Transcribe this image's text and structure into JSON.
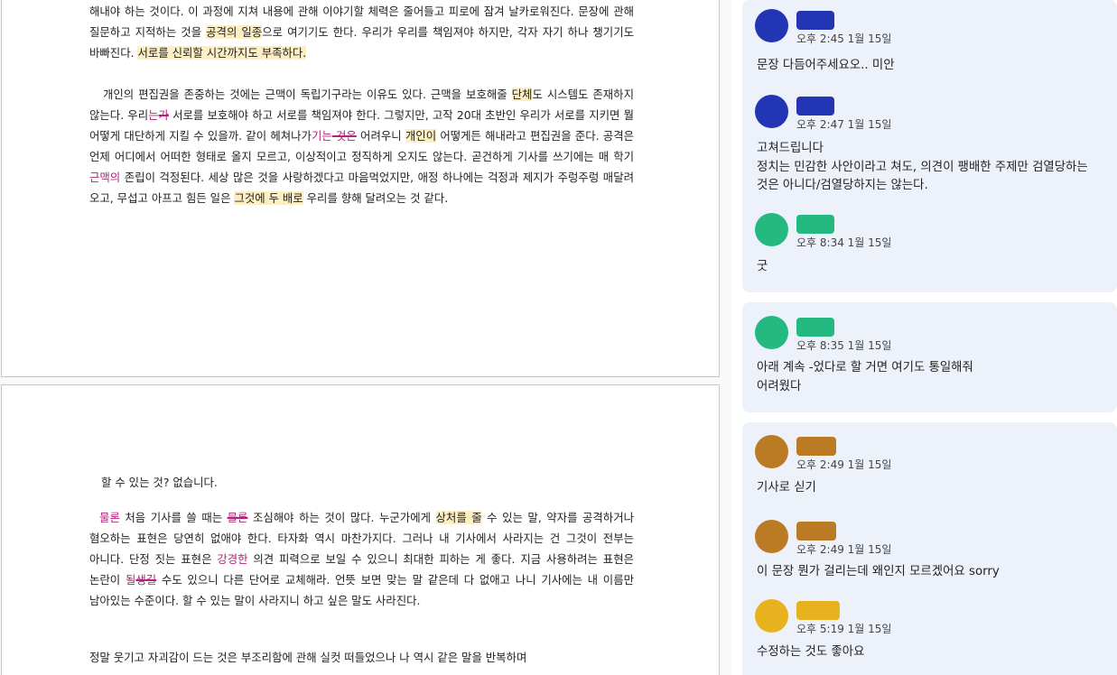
{
  "colors": {
    "highlight": "#fdefc3",
    "suggestion": "#b0247a",
    "thread_bg": "#edf2fa",
    "avatar_blue": "#2236b5",
    "avatar_green": "#25b982",
    "avatar_brown": "#bb7a24",
    "avatar_yellow": "#e8b21f"
  },
  "page1": {
    "para1": [
      {
        "t": "해내야 하는 것이다. 이 과정에 지쳐 내용에 관해 이야기할 체력은 줄어들고 피로에 잠겨 날카로워진다. 문장에 관해 질문하고 지적하는 것을 ",
        "s": ""
      },
      {
        "t": "공격의 일종",
        "s": "hl"
      },
      {
        "t": "으로 여기기도 한다. 우리가 우리를 책임져야 하지만, 각자 자기 하나 챙기기도 바빠진다. ",
        "s": ""
      },
      {
        "t": "서로를 신뢰할 시간까지도 부족하다.",
        "s": "hl"
      }
    ],
    "para2": [
      {
        "t": "   개인의 편집권을 존중하는 것에는 근맥이 독립기구라는 이유도 있다. 근맥을 보호해줄 ",
        "s": ""
      },
      {
        "t": "단체",
        "s": "hl"
      },
      {
        "t": "도 시스템도 존재하지 않는다. 우리",
        "s": ""
      },
      {
        "t": "는",
        "s": "ins"
      },
      {
        "t": "가",
        "s": "del"
      },
      {
        "t": " 서로를 보호해야 하고 서로를 책임져야 한다. 그렇지만, 고작 20대 초반인 우리가 서로를 지키면 뭘 어떻게 대단하게 지킬 수 있을까. 같이 헤쳐나가",
        "s": ""
      },
      {
        "t": "기는",
        "s": "ins"
      },
      {
        "t": " 것은",
        "s": "del"
      },
      {
        "t": " 어려우니 ",
        "s": ""
      },
      {
        "t": "개인이",
        "s": "hl"
      },
      {
        "t": " 어떻게든 해내라고 편집권을 준다. 공격은 언제 어디에서 어떠한 형태로 올지 모르고, 이상적이고 정직하게 오지도 않는다. 곧건하게 기사를 쓰기에는 매 학기 ",
        "s": ""
      },
      {
        "t": "근맥의",
        "s": "ins"
      },
      {
        "t": " 존립이 걱정된다. 세상 많은 것을 사랑하겠다고 마음먹었지만, 애정 하나에는 걱정과 제지가 주렁주렁 매달려 오고, 무섭고 아프고 힘든 일은 ",
        "s": ""
      },
      {
        "t": "그것에 두 배로",
        "s": "hl"
      },
      {
        "t": " 우리를 향해 달려오는 것 같다.",
        "s": ""
      }
    ]
  },
  "page2": {
    "line1": "할 수 있는 것? 없습니다.",
    "para1": [
      {
        "t": "  ",
        "s": ""
      },
      {
        "t": "물론",
        "s": "ins"
      },
      {
        "t": " 처음 기사를 쓸 때는 ",
        "s": ""
      },
      {
        "t": "물론",
        "s": "del"
      },
      {
        "t": " 조심해야 하는 것이 많다. 누군가에게 ",
        "s": ""
      },
      {
        "t": "상처를 줄",
        "s": "hl"
      },
      {
        "t": " 수 있는 말, 약자를 공격하거나 혐오하는 표현은 당연히 없애야 한다. 타자화 역시 마찬가지다. 그러나 내 기사에서 사라지는 건 그것이 전부는 아니다. 단정 짓는 표현은 ",
        "s": ""
      },
      {
        "t": "강경한",
        "s": "ins"
      },
      {
        "t": " 의견 피력으로 보일 수 있으니 최대한 피하는 게 좋다. 지금 사용하려는 표현은 논란이 ",
        "s": ""
      },
      {
        "t": "될",
        "s": "ins"
      },
      {
        "t": "생길",
        "s": "del"
      },
      {
        "t": " 수도 있으니 다른 단어로 교체해라. 언뜻 보면 맞는 말 같은데 다 없애고 나니 기사에는 내 이름만 남아있는 수준이다. 할 수 있는 말이 사라지니 하고 싶은 말도 사라진다.",
        "s": ""
      }
    ],
    "para2": "   정말 웃기고 자괴감이 드는 것은 부조리함에 관해 실컷 떠들었으나 나 역시 같은 말을 반복하며"
  },
  "threads": [
    {
      "comments": [
        {
          "color": "avatar_blue",
          "time": "오후 2:45 1월 15일",
          "text": "문장 다듬어주세요오.. 미안"
        },
        {
          "color": "avatar_blue",
          "time": "오후 2:47 1월 15일",
          "text": "고쳐드립니다\n정치는 민감한 사안이라고 쳐도, 의견이 팽배한 주제만 검열당하는 것은 아니다/검열당하지는 않는다."
        },
        {
          "color": "avatar_green",
          "time": "오후 8:34 1월 15일",
          "text": "굿"
        }
      ]
    },
    {
      "comments": [
        {
          "color": "avatar_green",
          "time": "오후 8:35 1월 15일",
          "text": "아래 계속 -었다로 할 거면 여기도 통일해줘\n어려웠다"
        }
      ]
    },
    {
      "comments": [
        {
          "color": "avatar_brown",
          "time": "오후 2:49 1월 15일",
          "text": "기사로 싣기"
        },
        {
          "color": "avatar_brown",
          "time": "오후 2:49 1월 15일",
          "text": "이 문장 뭔가 걸리는데 왜인지 모르겠어요 sorry"
        },
        {
          "color": "avatar_yellow",
          "time": "오후 5:19 1월 15일",
          "text": "수정하는 것도 좋아요"
        }
      ]
    }
  ]
}
